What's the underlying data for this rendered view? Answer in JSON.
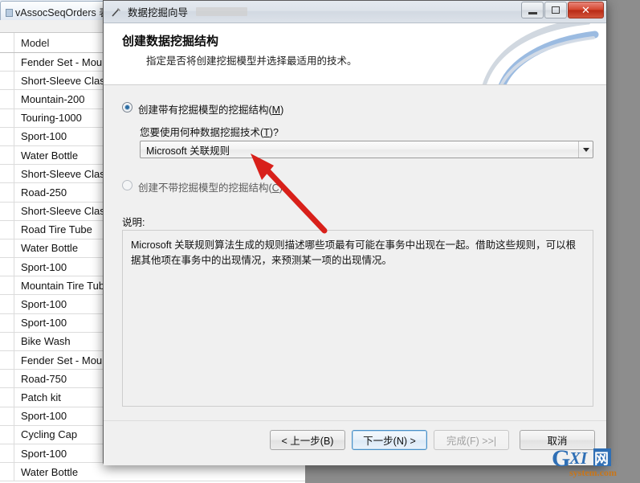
{
  "background_window": {
    "tab_label": "vAssocSeqOrders 表",
    "tab_icon": "table-icon",
    "grid": {
      "column_header": "Model",
      "rows": [
        "Fender Set - Mou",
        "Short-Sleeve Class",
        "Mountain-200",
        "Touring-1000",
        "Sport-100",
        "Water Bottle",
        "Short-Sleeve Class",
        "Road-250",
        "Short-Sleeve Class",
        "Road Tire Tube",
        "Water Bottle",
        "Sport-100",
        "Mountain Tire Tub",
        "Sport-100",
        "Sport-100",
        "Bike Wash",
        "Fender Set - Mou",
        "Road-750",
        "Patch kit",
        "Sport-100",
        "Cycling Cap",
        "Sport-100",
        "Water Bottle"
      ]
    }
  },
  "dialog": {
    "title": "数据挖掘向导",
    "title_icon": "wizard-wand-icon",
    "caption_buttons": {
      "minimize": "minimize-icon",
      "maximize": "maximize-icon",
      "close": "✕"
    },
    "header": {
      "heading": "创建数据挖掘结构",
      "subheading": "指定是否将创建挖掘模型并选择最适用的技术。"
    },
    "options": {
      "with_model": {
        "label_pre": "创建带有挖掘模型的挖掘结构(",
        "accel": "M",
        "label_post": ")",
        "selected": true
      },
      "without_model": {
        "label_pre": "创建不带挖掘模型的挖掘结构(",
        "accel": "C",
        "label_post": ")",
        "selected": false
      }
    },
    "technique": {
      "label_pre": "您要使用何种数据挖掘技术(",
      "accel": "T",
      "label_post": ")?",
      "selected_value": "Microsoft 关联规则",
      "caret_icon": "chevron-down-icon"
    },
    "description": {
      "label": "说明:",
      "text": "Microsoft 关联规则算法生成的规则描述哪些项最有可能在事务中出现在一起。借助这些规则，可以根据其他项在事务中的出现情况，来预测某一项的出现情况。"
    },
    "footer_buttons": {
      "back": "< 上一步(B)",
      "next": "下一步(N) >",
      "finish": "完成(F) >>|",
      "cancel": "取消"
    }
  },
  "annotation": {
    "arrow_color": "#d8201a",
    "arrow_name": "red-pointer-arrow"
  },
  "watermark": {
    "brand": "GXI网",
    "domain": "system.com"
  }
}
